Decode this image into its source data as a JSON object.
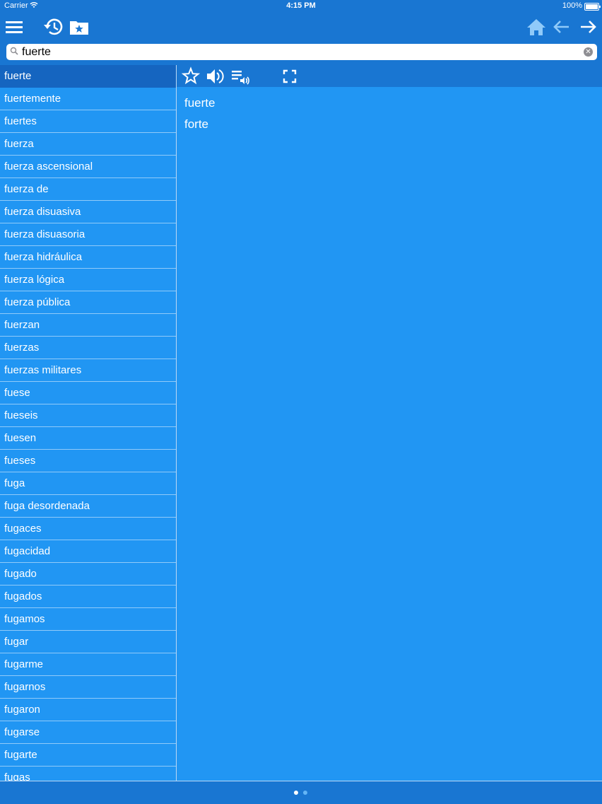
{
  "status": {
    "carrier": "Carrier",
    "time": "4:15 PM",
    "battery": "100%"
  },
  "toolbar": {
    "menu_icon": "hamburger-menu-icon",
    "history_icon": "history-icon",
    "favorites_icon": "favorites-folder-icon",
    "home_icon": "home-icon",
    "back_icon": "arrow-left-icon",
    "forward_icon": "arrow-right-icon"
  },
  "search": {
    "value": "fuerte",
    "placeholder": ""
  },
  "word_list": [
    "fuerte",
    "fuertemente",
    "fuertes",
    "fuerza",
    "fuerza ascensional",
    "fuerza de",
    "fuerza disuasiva",
    "fuerza disuasoria",
    "fuerza hidráulica",
    "fuerza lógica",
    "fuerza pública",
    "fuerzan",
    "fuerzas",
    "fuerzas militares",
    "fuese",
    "fueseis",
    "fuesen",
    "fueses",
    "fuga",
    "fuga desordenada",
    "fugaces",
    "fugacidad",
    "fugado",
    "fugados",
    "fugamos",
    "fugar",
    "fugarme",
    "fugarnos",
    "fugaron",
    "fugarse",
    "fugarte",
    "fugas"
  ],
  "selected_index": 0,
  "detail": {
    "word": "fuerte",
    "translation": "forte"
  },
  "page_indicator": {
    "pages": 2,
    "current": 1
  },
  "colors": {
    "background": "#2196F3",
    "bar": "#1976D2",
    "selected": "#1565C0"
  }
}
